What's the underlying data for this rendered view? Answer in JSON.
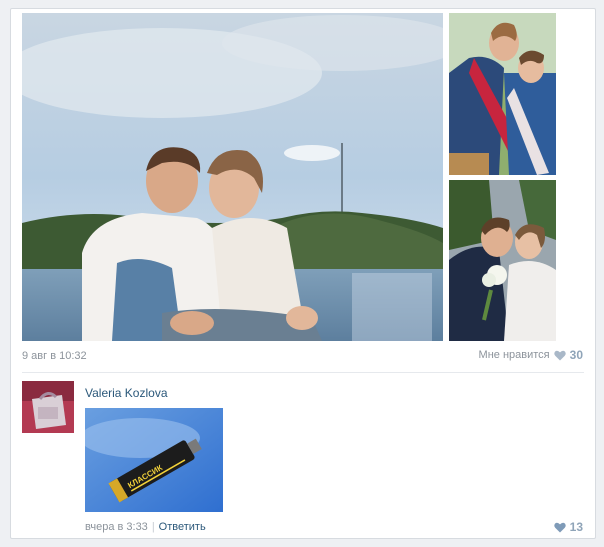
{
  "post": {
    "date": "9 авг в 10:32",
    "like_label": "Мне нравится",
    "like_count": "30"
  },
  "comment": {
    "author": "Valeria Kozlova",
    "date": "вчера в 3:33",
    "reply_label": "Ответить",
    "like_count": "13"
  },
  "attachment": {
    "product_text": "КЛАССИК"
  },
  "colors": {
    "link": "#2b587a",
    "muted": "#8c939b",
    "heart": "#a9b8c8"
  }
}
